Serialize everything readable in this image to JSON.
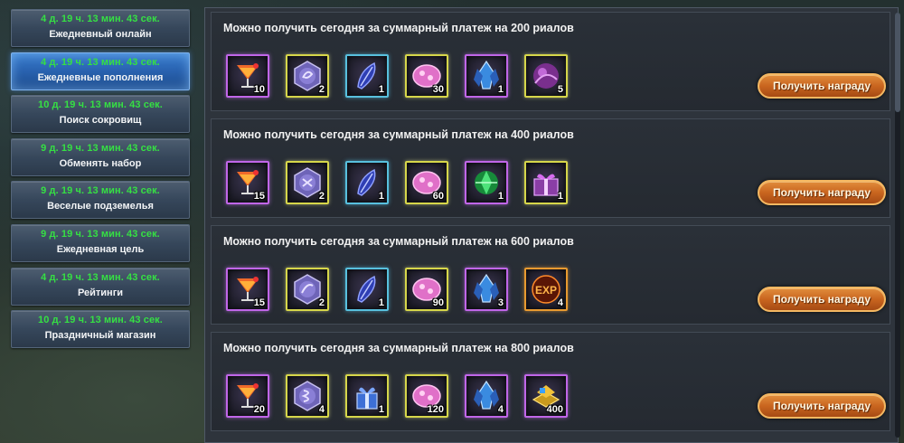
{
  "sidebar": {
    "items": [
      {
        "timer": "4 д. 19 ч. 13 мин. 43 сек.",
        "label": "Ежедневный онлайн"
      },
      {
        "timer": "4 д. 19 ч. 13 мин. 43 сек.",
        "label": "Ежедневные пополнения",
        "active": true
      },
      {
        "timer": "10 д. 19 ч. 13 мин. 43 сек.",
        "label": "Поиск сокровищ"
      },
      {
        "timer": "9 д. 19 ч. 13 мин. 43 сек.",
        "label": "Обменять набор"
      },
      {
        "timer": "9 д. 19 ч. 13 мин. 43 сек.",
        "label": "Веселые подземелья"
      },
      {
        "timer": "9 д. 19 ч. 13 мин. 43 сек.",
        "label": "Ежедневная цель"
      },
      {
        "timer": "4 д. 19 ч. 13 мин. 43 сек.",
        "label": "Рейтинги"
      },
      {
        "timer": "10 д. 19 ч. 13 мин. 43 сек.",
        "label": "Праздничный магазин"
      }
    ]
  },
  "tiers": [
    {
      "title": "Можно получить сегодня за суммарный платеж на 200 риалов",
      "button": "Получить награду",
      "rewards": [
        {
          "icon": "cocktail-icon",
          "qty": "10",
          "frame": "purple"
        },
        {
          "icon": "rune-coin-icon",
          "qty": "2",
          "frame": "yellow"
        },
        {
          "icon": "blue-feather-icon",
          "qty": "1",
          "frame": "blue"
        },
        {
          "icon": "pink-gem-icon",
          "qty": "30",
          "frame": "yellow"
        },
        {
          "icon": "blue-crystal-icon",
          "qty": "1",
          "frame": "purple"
        },
        {
          "icon": "purple-orb-icon",
          "qty": "5",
          "frame": "yellow"
        }
      ]
    },
    {
      "title": "Можно получить сегодня за суммарный платеж на 400 риалов",
      "button": "Получить награду",
      "rewards": [
        {
          "icon": "cocktail-icon",
          "qty": "15",
          "frame": "purple"
        },
        {
          "icon": "rune-coin-icon",
          "qty": "2",
          "frame": "yellow"
        },
        {
          "icon": "blue-feather-icon",
          "qty": "1",
          "frame": "blue"
        },
        {
          "icon": "pink-gem-icon",
          "qty": "60",
          "frame": "yellow"
        },
        {
          "icon": "green-crystal-icon",
          "qty": "1",
          "frame": "purple"
        },
        {
          "icon": "gift-box-icon",
          "qty": "1",
          "frame": "yellow"
        }
      ]
    },
    {
      "title": "Можно получить сегодня за суммарный платеж на 600 риалов",
      "button": "Получить награду",
      "rewards": [
        {
          "icon": "cocktail-icon",
          "qty": "15",
          "frame": "purple"
        },
        {
          "icon": "rune-coin-icon",
          "qty": "2",
          "frame": "yellow"
        },
        {
          "icon": "blue-feather-icon",
          "qty": "1",
          "frame": "blue"
        },
        {
          "icon": "pink-gem-icon",
          "qty": "90",
          "frame": "yellow"
        },
        {
          "icon": "blue-crystal-icon",
          "qty": "3",
          "frame": "purple"
        },
        {
          "icon": "exp-icon",
          "qty": "4",
          "frame": "orange",
          "text": "EXP"
        }
      ]
    },
    {
      "title": "Можно получить сегодня за суммарный платеж на 800 риалов",
      "button": "Получить награду",
      "rewards": [
        {
          "icon": "cocktail-icon",
          "qty": "20",
          "frame": "purple"
        },
        {
          "icon": "rune-coin-icon",
          "qty": "4",
          "frame": "yellow"
        },
        {
          "icon": "blue-gift-icon",
          "qty": "1",
          "frame": "yellow"
        },
        {
          "icon": "pink-gem-icon",
          "qty": "120",
          "frame": "yellow"
        },
        {
          "icon": "blue-crystal-icon",
          "qty": "4",
          "frame": "purple"
        },
        {
          "icon": "gold-chest-icon",
          "qty": "400",
          "frame": "purple"
        }
      ]
    }
  ]
}
